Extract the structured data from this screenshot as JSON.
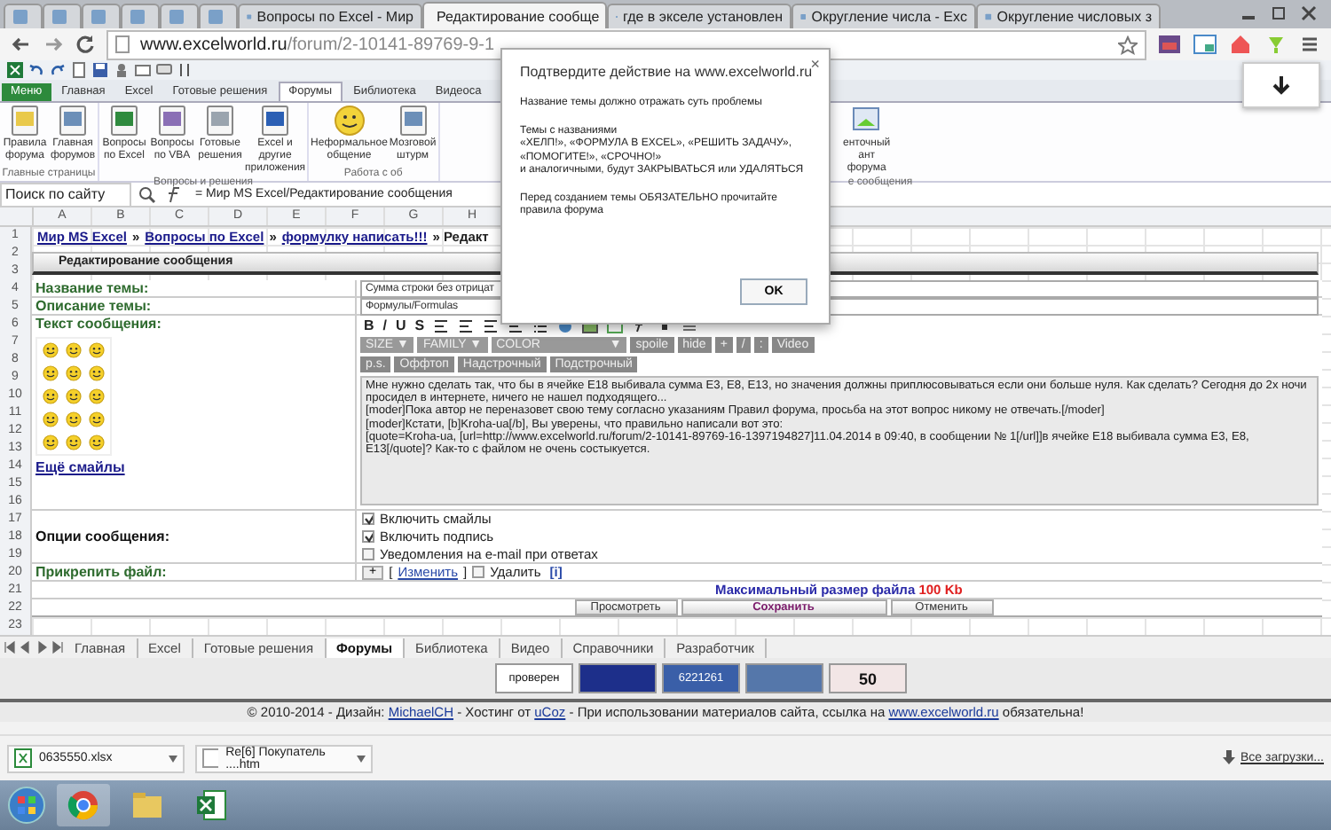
{
  "browser": {
    "tabs": [
      {
        "selected": false
      },
      {
        "selected": false
      },
      {
        "selected": false
      },
      {
        "selected": false
      },
      {
        "selected": false
      },
      {
        "selected": false
      },
      {
        "title": "Вопросы по Excel - Мир",
        "selected": false
      },
      {
        "title": "Редактирование сообще",
        "selected": true
      },
      {
        "title": "где в экселе установлен",
        "selected": false
      },
      {
        "title": "Округление числа - Exc",
        "selected": false
      },
      {
        "title": "Округление числовых з",
        "selected": false
      }
    ],
    "url_host": "www.excelworld.ru",
    "url_path": "/forum/2-10141-89769-9-1"
  },
  "ribbon": {
    "tabs": [
      {
        "label": "Меню",
        "kind": "file",
        "selected": false
      },
      {
        "label": "Главная",
        "kind": "tab",
        "selected": false
      },
      {
        "label": "Excel",
        "kind": "tab",
        "selected": false
      },
      {
        "label": "Готовые решения",
        "kind": "tab",
        "selected": false
      },
      {
        "label": "Форумы",
        "kind": "tab",
        "selected": true
      },
      {
        "label": "Библиотека",
        "kind": "tab",
        "selected": false
      },
      {
        "label": "Видеоса",
        "kind": "tab",
        "selected": false
      }
    ],
    "groups": [
      {
        "caption": "Главные страницы",
        "buttons": [
          {
            "label": "Правила форума",
            "kind": "note"
          },
          {
            "label": "Главная форумов",
            "kind": "people"
          }
        ]
      },
      {
        "caption": "Вопросы и решения",
        "buttons": [
          {
            "label": "Вопросы по Excel",
            "kind": "sheet"
          },
          {
            "label": "Вопросы по VBA",
            "kind": "grid"
          },
          {
            "label": "Готовые решения",
            "kind": "search"
          },
          {
            "label": "Excel и другие приложения",
            "kind": "word"
          }
        ]
      },
      {
        "caption": "Работа с об",
        "buttons": [
          {
            "label": "Неформальное общение",
            "kind": "smiley"
          },
          {
            "label": "Мозговой штурм",
            "kind": "people"
          }
        ]
      }
    ],
    "hidden_tail": [
      {
        "label": "енточный ант форума"
      }
    ],
    "hidden_caption": "е сообщения"
  },
  "formula_bar": {
    "name_box": "Поиск по сайту",
    "formula": "= Мир MS Excel/Редактирование сообщения"
  },
  "columns": [
    "A",
    "B",
    "C",
    "D",
    "E",
    "F",
    "G",
    "H"
  ],
  "rows": [
    "1",
    "2",
    "3",
    "4",
    "5",
    "6",
    "7",
    "8",
    "9",
    "10",
    "11",
    "12",
    "13",
    "14",
    "15",
    "16",
    "17",
    "18",
    "19",
    "20",
    "21",
    "22",
    "23"
  ],
  "form": {
    "breadcrumb": [
      {
        "text": "Мир MS Excel",
        "link": true
      },
      {
        "text": "»",
        "link": false
      },
      {
        "text": "Вопросы по Excel",
        "link": true
      },
      {
        "text": "»",
        "link": false
      },
      {
        "text": "формулку написать!!!",
        "link": true
      },
      {
        "text": "» Редакт",
        "link": false
      }
    ],
    "header": "Редактирование сообщения",
    "title_label": "Название темы:",
    "title_value": "Сумма строки без отрицат",
    "desc_label": "Описание темы:",
    "desc_value": "Формулы/Formulas",
    "text_label": "Текст сообщения:",
    "more_smileys": "Ещё смайлы",
    "format_buttons": [
      "B",
      "/",
      "U",
      "S"
    ],
    "tag_buttons": [
      {
        "label": "SIZE ▼",
        "kind": "select"
      },
      {
        "label": "FAMILY ▼",
        "kind": "select"
      },
      {
        "label": "COLOR                    ▼",
        "kind": "select"
      },
      {
        "label": "spoile",
        "kind": "tag"
      },
      {
        "label": "hide",
        "kind": "tag"
      },
      {
        "label": "+",
        "kind": "tag"
      },
      {
        "label": "/",
        "kind": "tag"
      },
      {
        "label": ":",
        "kind": "tag"
      },
      {
        "label": "Video",
        "kind": "tag"
      }
    ],
    "tag_buttons_2": [
      "p.s.",
      "Оффтоп",
      "Надстрочный",
      "Подстрочный"
    ],
    "message": "Мне нужно сделать так, что бы в ячейке E18 выбивала сумма E3, E8, E13, но значения должны приплюсовываться если они больше нуля. Как сделать? Сегодня до 2х ночи просидел в интернете, ничего не нашел подходящего...\n[moder]Пока автор не переназовет свою тему согласно указаниям Правил форума, просьба на этот вопрос никому не отвечать.[/moder]\n[moder]Кстати, [b]Kroha-ua[/b], Вы уверены, что правильно написали вот это:\n[quote=Kroha-ua, [url=http://www.excelworld.ru/forum/2-10141-89769-16-1397194827]11.04.2014 в 09:40, в сообщении № 1[/url]]в ячейке E18 выбивала сумма E3, E8, E13[/quote]? Как-то с файлом не очень состыкуется.",
    "options_label": "Опции сообщения:",
    "options": [
      {
        "label": "Включить смайлы",
        "checked": true
      },
      {
        "label": "Включить подпись",
        "checked": true
      },
      {
        "label": "Уведомления на e-mail при ответах",
        "checked": false
      }
    ],
    "attach_label": "Прикрепить файл:",
    "attach": {
      "add": "+",
      "change_open": "[",
      "change": "Изменить",
      "change_close": "]",
      "delete": "Удалить",
      "delete_checked": false,
      "info": "[i]"
    },
    "max_size": "Максимальный размер файла",
    "max_size_value": "100 Kb",
    "buttons": [
      "Просмотреть",
      "Сохранить",
      "Отменить"
    ]
  },
  "sheet_tabs": [
    {
      "label": "Главная",
      "selected": false
    },
    {
      "label": "Excel",
      "selected": false
    },
    {
      "label": "Готовые решения",
      "selected": false
    },
    {
      "label": "Форумы",
      "selected": true
    },
    {
      "label": "Библиотека",
      "selected": false
    },
    {
      "label": "Видео",
      "selected": false
    },
    {
      "label": "Справочники",
      "selected": false
    },
    {
      "label": "Разработчик",
      "selected": false
    }
  ],
  "badges": [
    {
      "text": "проверен",
      "kind": "check"
    },
    {
      "kind": "chart"
    },
    {
      "text": "6221261",
      "kind": "mail"
    },
    {
      "kind": "counter"
    },
    {
      "text": "50",
      "kind": "yandex"
    }
  ],
  "footer": [
    {
      "text": "© 2010-2014 - Дизайн: ",
      "link": false
    },
    {
      "text": "MichaelCH",
      "link": true
    },
    {
      "text": " - Хостинг от ",
      "link": false
    },
    {
      "text": "uCoz",
      "link": true
    },
    {
      "text": " - При использовании материалов сайта, ссылка на ",
      "link": false
    },
    {
      "text": "www.excelworld.ru",
      "link": true
    },
    {
      "text": " обязательна!",
      "link": false
    }
  ],
  "downloads": {
    "items": [
      {
        "name": "0635550.xlsx",
        "kind": "excel"
      },
      {
        "name": "Re[6] Покупатель ....htm",
        "kind": "page"
      }
    ],
    "all": "Все загрузки..."
  },
  "dialog": {
    "title": "Подтвердите действие на www.excelworld.ru",
    "close": "×",
    "paragraphs": [
      "Название темы должно отражать суть проблемы",
      "Темы с названиями\n«ХЕЛП!», «ФОРМУЛА В EXCEL», «РЕШИТЬ ЗАДАЧУ», «ПОМОГИТЕ!», «СРОЧНО!»\nи аналогичными, будут ЗАКРЫВАТЬСЯ или УДАЛЯТЬСЯ",
      "Перед созданием темы ОБЯЗАТЕЛЬНО прочитайте правила форума"
    ],
    "ok": "OK"
  }
}
